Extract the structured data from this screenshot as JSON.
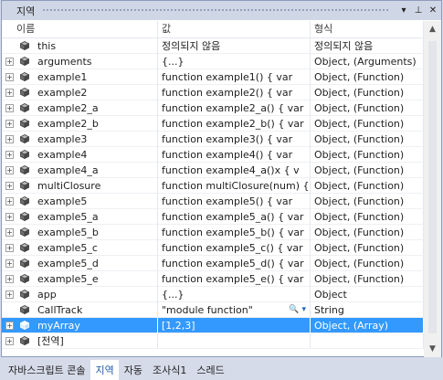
{
  "panel": {
    "title": "지역"
  },
  "toolbar": {
    "dropdown_glyph": "▾",
    "pin_glyph": "⊥",
    "close_glyph": "✕"
  },
  "columns": {
    "name": "이름",
    "value": "값",
    "type": "형식"
  },
  "rows": [
    {
      "name": "this",
      "value": "정의되지 않음",
      "type": "정의되지 않음",
      "expandable": false,
      "selected": false
    },
    {
      "name": "arguments",
      "value": "{...}",
      "type": "Object, (Arguments)",
      "expandable": true,
      "selected": false
    },
    {
      "name": "example1",
      "value": "function example1()   {     var",
      "type": "Object, (Function)",
      "expandable": true,
      "selected": false
    },
    {
      "name": "example2",
      "value": "function example2()   {     var",
      "type": "Object, (Function)",
      "expandable": true,
      "selected": false
    },
    {
      "name": "example2_a",
      "value": "function example2_a()   {     var",
      "type": "Object, (Function)",
      "expandable": true,
      "selected": false
    },
    {
      "name": "example2_b",
      "value": "function example2_b()   {     var",
      "type": "Object, (Function)",
      "expandable": true,
      "selected": false
    },
    {
      "name": "example3",
      "value": "function example3()   {     var",
      "type": "Object, (Function)",
      "expandable": true,
      "selected": false
    },
    {
      "name": "example4",
      "value": "function example4()   {     var",
      "type": "Object, (Function)",
      "expandable": true,
      "selected": false
    },
    {
      "name": "example4_a",
      "value": "function example4_a()x   {     v",
      "type": "Object, (Function)",
      "expandable": true,
      "selected": false
    },
    {
      "name": "multiClosure",
      "value": "function multiClosure(num) {",
      "type": "Object, (Function)",
      "expandable": true,
      "selected": false
    },
    {
      "name": "example5",
      "value": "function example5()   {     var",
      "type": "Object, (Function)",
      "expandable": true,
      "selected": false
    },
    {
      "name": "example5_a",
      "value": "function example5_a()   {     var",
      "type": "Object, (Function)",
      "expandable": true,
      "selected": false
    },
    {
      "name": "example5_b",
      "value": "function example5_b()   {     var",
      "type": "Object, (Function)",
      "expandable": true,
      "selected": false
    },
    {
      "name": "example5_c",
      "value": "function example5_c()   {     var",
      "type": "Object, (Function)",
      "expandable": true,
      "selected": false
    },
    {
      "name": "example5_d",
      "value": "function example5_d()   {     var",
      "type": "Object, (Function)",
      "expandable": true,
      "selected": false
    },
    {
      "name": "example5_e",
      "value": "function example5_e()   {     var",
      "type": "Object, (Function)",
      "expandable": true,
      "selected": false
    },
    {
      "name": "app",
      "value": "{...}",
      "type": "Object",
      "expandable": true,
      "selected": false
    },
    {
      "name": "CallTrack",
      "value": "\"module function\"",
      "type": "String",
      "expandable": false,
      "selected": false,
      "has_tools": true
    },
    {
      "name": "myArray",
      "value": "[1,2,3]",
      "type": "Object, (Array)",
      "expandable": true,
      "selected": true
    },
    {
      "name": "[전역]",
      "value": "",
      "type": "",
      "expandable": true,
      "selected": false
    }
  ],
  "tabs": [
    {
      "label": "자바스크립트 콘솔",
      "active": false
    },
    {
      "label": "지역",
      "active": true
    },
    {
      "label": "자동",
      "active": false
    },
    {
      "label": "조사식1",
      "active": false
    },
    {
      "label": "스레드",
      "active": false
    }
  ],
  "colors": {
    "selection": "#3399FF",
    "frame": "#D6DBE9",
    "titlebar": "#CFD6E5",
    "active_tab_text": "#1E5AA8"
  },
  "icons": {
    "expander": "plus-box-icon",
    "object": "cube-icon",
    "magnifier": "magnifier-icon",
    "dropdown": "dropdown-arrow-icon"
  }
}
